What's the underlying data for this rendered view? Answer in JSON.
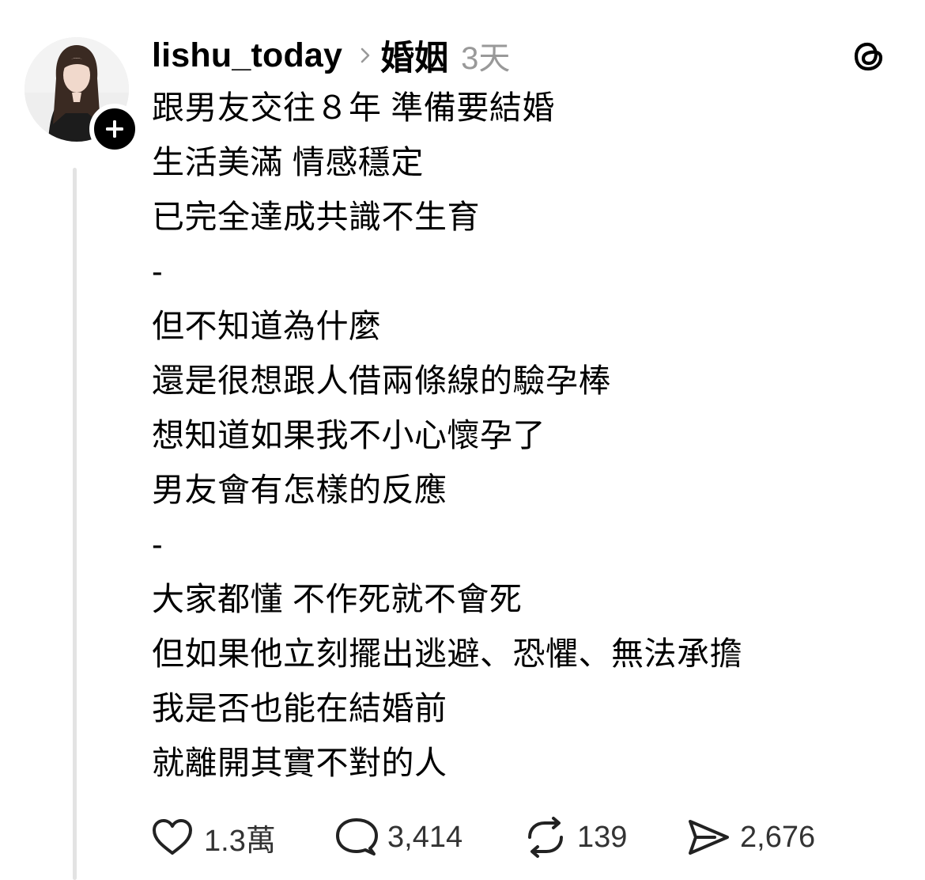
{
  "post": {
    "username": "lishu_today",
    "topic": "婚姻",
    "time": "3天",
    "lines": [
      "跟男友交往８年 準備要結婚",
      "生活美滿 情感穩定",
      "已完全達成共識不生育",
      "-",
      "但不知道為什麼",
      "還是很想跟人借兩條線的驗孕棒",
      "想知道如果我不小心懷孕了",
      "男友會有怎樣的反應",
      "-",
      "大家都懂 不作死就不會死",
      "但如果他立刻擺出逃避、恐懼、無法承擔",
      "我是否也能在結婚前",
      "就離開其實不對的人"
    ]
  },
  "actions": {
    "likes": "1.3萬",
    "replies": "3,414",
    "reposts": "139",
    "shares": "2,676"
  },
  "icons": {
    "avatar": "profile-photo",
    "follow": "plus-icon",
    "chevron": "chevron-right-icon",
    "logo": "threads-logo-icon",
    "like": "heart-icon",
    "reply": "comment-bubble-icon",
    "repost": "repost-icon",
    "share": "send-icon"
  },
  "colors": {
    "text": "#000000",
    "muted": "#999999",
    "thread_line": "#e3e3e3"
  }
}
